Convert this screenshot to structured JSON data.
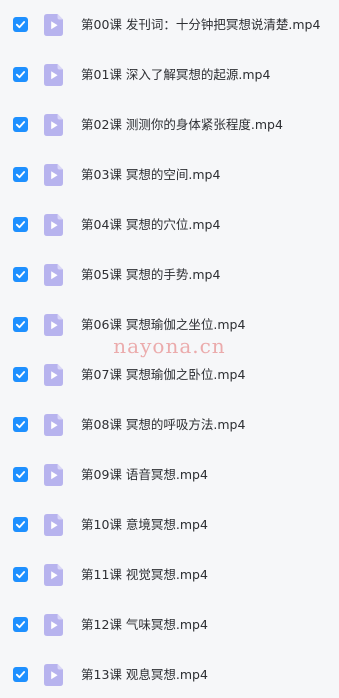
{
  "files": [
    {
      "name": "第00课 发刊词：十分钟把冥想说清楚.mp4",
      "selected": true
    },
    {
      "name": "第01课 深入了解冥想的起源.mp4",
      "selected": true
    },
    {
      "name": "第02课 测测你的身体紧张程度.mp4",
      "selected": true
    },
    {
      "name": "第03课 冥想的空间.mp4",
      "selected": true
    },
    {
      "name": "第04课 冥想的穴位.mp4",
      "selected": true
    },
    {
      "name": "第05课 冥想的手势.mp4",
      "selected": true
    },
    {
      "name": "第06课 冥想瑜伽之坐位.mp4",
      "selected": true
    },
    {
      "name": "第07课 冥想瑜伽之卧位.mp4",
      "selected": true
    },
    {
      "name": "第08课 冥想的呼吸方法.mp4",
      "selected": true
    },
    {
      "name": "第09课 语音冥想.mp4",
      "selected": true
    },
    {
      "name": "第10课 意境冥想.mp4",
      "selected": true
    },
    {
      "name": "第11课 视觉冥想.mp4",
      "selected": true
    },
    {
      "name": "第12课 气味冥想.mp4",
      "selected": true
    },
    {
      "name": "第13课 观息冥想.mp4",
      "selected": true
    }
  ],
  "watermark": "nayona.cn",
  "colors": {
    "checkbox": "#1e90ff",
    "video_icon_bg": "#b7b3ee",
    "video_icon_play": "#ffffff",
    "background": "#f6f7f9",
    "watermark": "#e16e6e"
  }
}
